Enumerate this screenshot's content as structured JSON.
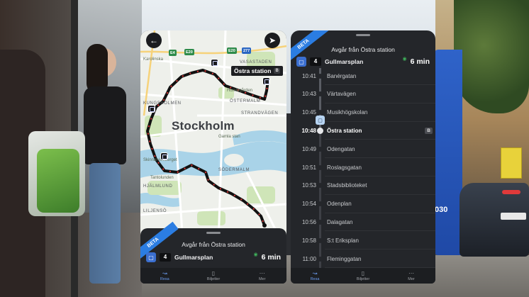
{
  "map_screen": {
    "city_label": "Stockholm",
    "area_labels": {
      "gamla_stan": "Gamla stan",
      "sodermalm": "SÖDERMALM",
      "ostermalm": "ÖSTERMALM",
      "strandvagen": "STRANDVÄGEN",
      "humlegarden": "Humlegården",
      "tantolunden": "Tantolunden",
      "kungsholmen": "KUNGSHOLMEN",
      "karolinska": "Karolinska",
      "vasastaden": "VASASTADEN",
      "skinnarviksberget": "Skinnarviksberget",
      "hjalmar": "HJÄLMLUND",
      "lilla_essingen": "LILJENSÖ"
    },
    "road_shields": [
      "E4",
      "E20",
      "E20",
      "277"
    ],
    "stop_callout": {
      "name": "Östra station",
      "platform": "B"
    },
    "back_icon": "arrow-left-icon",
    "locate_icon": "navigation-arrow-icon"
  },
  "departure_sheet": {
    "beta_label": "BETA",
    "title": "Avgår från Östra station",
    "mode_icon": "bus-icon",
    "line": "4",
    "destination": "Gullmarsplan",
    "eta": "6 min",
    "live_icon": "realtime-signal-icon"
  },
  "stop_list": {
    "current_platform": "B",
    "stops": [
      {
        "time": "10:41",
        "name": "Banérgatan"
      },
      {
        "time": "10:43",
        "name": "Värtavägen"
      },
      {
        "time": "10:45",
        "name": "Musikhögskolan"
      },
      {
        "time": "10:48",
        "name": "Östra station"
      },
      {
        "time": "10:49",
        "name": "Odengatan"
      },
      {
        "time": "10:51",
        "name": "Roslagsgatan"
      },
      {
        "time": "10:53",
        "name": "Stadsbiblioteket"
      },
      {
        "time": "10:54",
        "name": "Odenplan"
      },
      {
        "time": "10:56",
        "name": "Dalagatan"
      },
      {
        "time": "10:58",
        "name": "S:t Eriksplan"
      },
      {
        "time": "11:00",
        "name": "Fleminggatan"
      }
    ]
  },
  "tabbar": {
    "tabs": [
      {
        "label": "Resa",
        "icon": "route-icon",
        "active": true
      },
      {
        "label": "Biljetter",
        "icon": "ticket-icon",
        "active": false
      },
      {
        "label": "Mer",
        "icon": "more-dots-icon",
        "active": false
      }
    ]
  },
  "background": {
    "bus_number": "030"
  },
  "colors": {
    "accent": "#2b7de2",
    "route_line": "#111111",
    "route_dash": "#d93636",
    "live_green": "#3fb05b"
  }
}
